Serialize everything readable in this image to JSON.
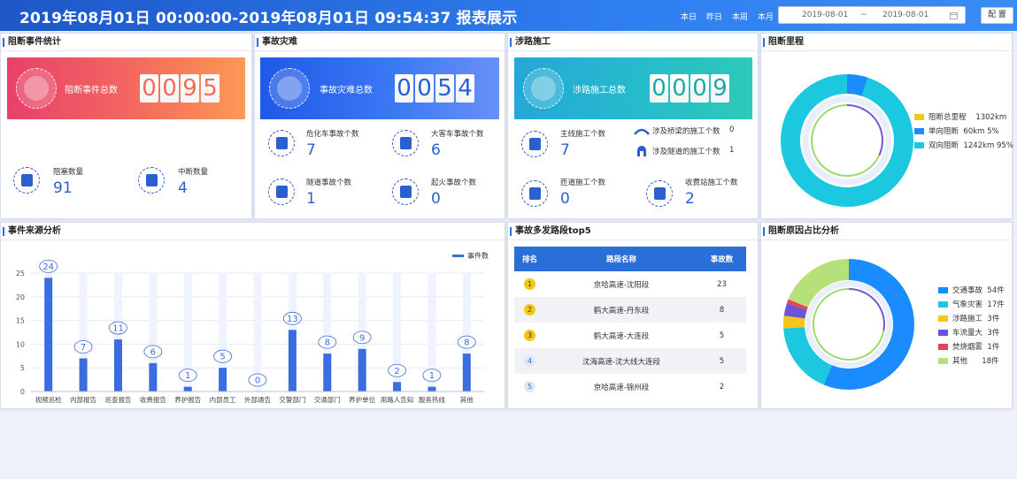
{
  "header": {
    "title": "2019年08月01日 00:00:00-2019年08月01日 09:54:37   报表展示",
    "quick_ranges": [
      "本日",
      "昨日",
      "本周",
      "本月"
    ],
    "date_start": "2019-08-01",
    "date_sep": "~",
    "date_end": "2019-08-01",
    "config_label": "配 置"
  },
  "blocking": {
    "title": "阻断事件统计",
    "banner_label": "阻断事件总数",
    "digits": [
      "0",
      "0",
      "9",
      "5"
    ],
    "stats": [
      {
        "label": "阻塞数量",
        "value": "91"
      },
      {
        "label": "中断数量",
        "value": "4"
      }
    ]
  },
  "accidents": {
    "title": "事故灾难",
    "banner_label": "事故灾难总数",
    "digits": [
      "0",
      "0",
      "5",
      "4"
    ],
    "stats": [
      {
        "label": "危化车事故个数",
        "value": "7"
      },
      {
        "label": "大客车事故个数",
        "value": "6"
      },
      {
        "label": "隧道事故个数",
        "value": "1"
      },
      {
        "label": "起火事故个数",
        "value": "0"
      }
    ]
  },
  "construction": {
    "title": "涉路施工",
    "banner_label": "涉路施工总数",
    "digits": [
      "0",
      "0",
      "0",
      "9"
    ],
    "stats": [
      {
        "label": "主线施工个数",
        "value": "7"
      },
      {
        "label": "匝道施工个数",
        "value": "0"
      },
      {
        "label": "收费站施工个数",
        "value": "2"
      }
    ],
    "small_stats": [
      {
        "label": "涉及桥梁的施工个数",
        "value": "0"
      },
      {
        "label": "涉及隧道的施工个数",
        "value": "1"
      }
    ]
  },
  "mileage": {
    "title": "阻断里程",
    "legend": [
      {
        "label": "阻断总里程",
        "value": "1302km",
        "color": "#f5c518"
      },
      {
        "label": "单向阻断",
        "value": "60km 5%",
        "color": "#1a8cff"
      },
      {
        "label": "双向阻断",
        "value": "1242km 95%",
        "color": "#1cc8e0"
      }
    ]
  },
  "sources": {
    "title": "事件来源分析",
    "chart_data": {
      "type": "bar",
      "categories": [
        "视频巡检",
        "内部报告",
        "巡查报告",
        "收费报告",
        "养护报告",
        "内部员工",
        "外部通告",
        "交警部门",
        "交通部门",
        "养护单位",
        "用路人告知",
        "服务热线",
        "其他"
      ],
      "series": [
        {
          "name": "事件数",
          "values": [
            24,
            7,
            11,
            6,
            1,
            5,
            0,
            13,
            8,
            9,
            2,
            1,
            8
          ]
        }
      ],
      "ylim": [
        0,
        25
      ],
      "yticks": [
        0,
        5,
        10,
        15,
        20,
        25
      ],
      "legend_position": "top-right",
      "grid": true,
      "color": "#3a6de0"
    }
  },
  "top5": {
    "title": "事故多发路段top5",
    "headers": [
      "排名",
      "路段名称",
      "事故数"
    ],
    "rows": [
      {
        "rank": "1",
        "name": "京哈高速-沈阳段",
        "count": "23"
      },
      {
        "rank": "2",
        "name": "鹤大高速-丹东段",
        "count": "8"
      },
      {
        "rank": "3",
        "name": "鹤大高速-大连段",
        "count": "5"
      },
      {
        "rank": "4",
        "name": "沈海高速-沈大线大连段",
        "count": "5"
      },
      {
        "rank": "5",
        "name": "京哈高速-锦州段",
        "count": "2"
      }
    ]
  },
  "causes": {
    "title": "阻断原因占比分析",
    "legend": [
      {
        "label": "交通事故",
        "value": "54件",
        "color": "#1a8cff"
      },
      {
        "label": "气象灾害",
        "value": "17件",
        "color": "#1cc8e0"
      },
      {
        "label": "涉路施工",
        "value": "3件",
        "color": "#f5c518"
      },
      {
        "label": "车流量大",
        "value": "3件",
        "color": "#6a55d8"
      },
      {
        "label": "焚烧烟雾",
        "value": "1件",
        "color": "#e8405a"
      },
      {
        "label": "其他",
        "value": "18件",
        "color": "#b6e07a"
      }
    ]
  }
}
